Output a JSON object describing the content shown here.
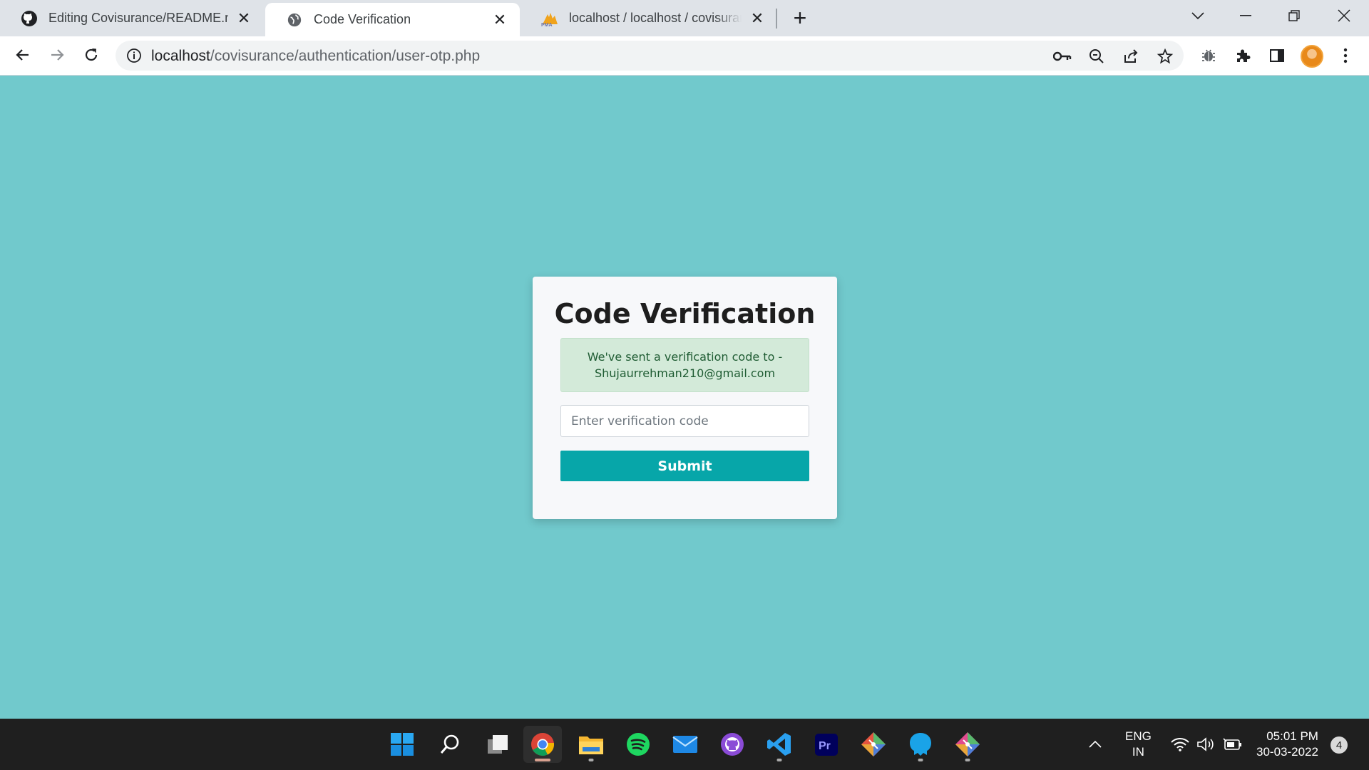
{
  "browser": {
    "tabs": [
      {
        "title": "Editing Covisurance/README.md",
        "icon": "github-icon"
      },
      {
        "title": "Code Verification",
        "icon": "globe-icon",
        "active": true
      },
      {
        "title": "localhost / localhost / covisurance",
        "icon": "phpmyadmin-icon"
      }
    ],
    "url_host": "localhost",
    "url_path": "/covisurance/authentication/user-otp.php",
    "toolbar_icons": [
      "key-icon",
      "zoom-out-icon",
      "share-icon",
      "star-icon",
      "bug-icon",
      "extensions-icon",
      "sidepanel-icon",
      "profile-avatar",
      "menu-icon"
    ]
  },
  "page": {
    "title": "Code Verification",
    "alert_line1": "We've sent a verification code to -",
    "alert_line2": "Shujaurrehman210@gmail.com",
    "input_placeholder": "Enter verification code",
    "input_value": "",
    "submit_label": "Submit"
  },
  "taskbar": {
    "apps": [
      "start-icon",
      "search-icon",
      "task-view-icon",
      "chrome-icon",
      "file-explorer-icon",
      "spotify-icon",
      "mail-icon",
      "github-desktop-icon",
      "vscode-icon",
      "premiere-pro-icon",
      "git-icon",
      "mysql-workbench-icon",
      "git-gui-icon"
    ],
    "language_line1": "ENG",
    "language_line2": "IN",
    "time": "05:01 PM",
    "date": "30-03-2022",
    "notification_count": "4"
  },
  "colors": {
    "page_background": "#71c9cc",
    "button": "#07a6a9",
    "alert_background": "#d3ead9",
    "alert_text": "#1f5c33"
  }
}
